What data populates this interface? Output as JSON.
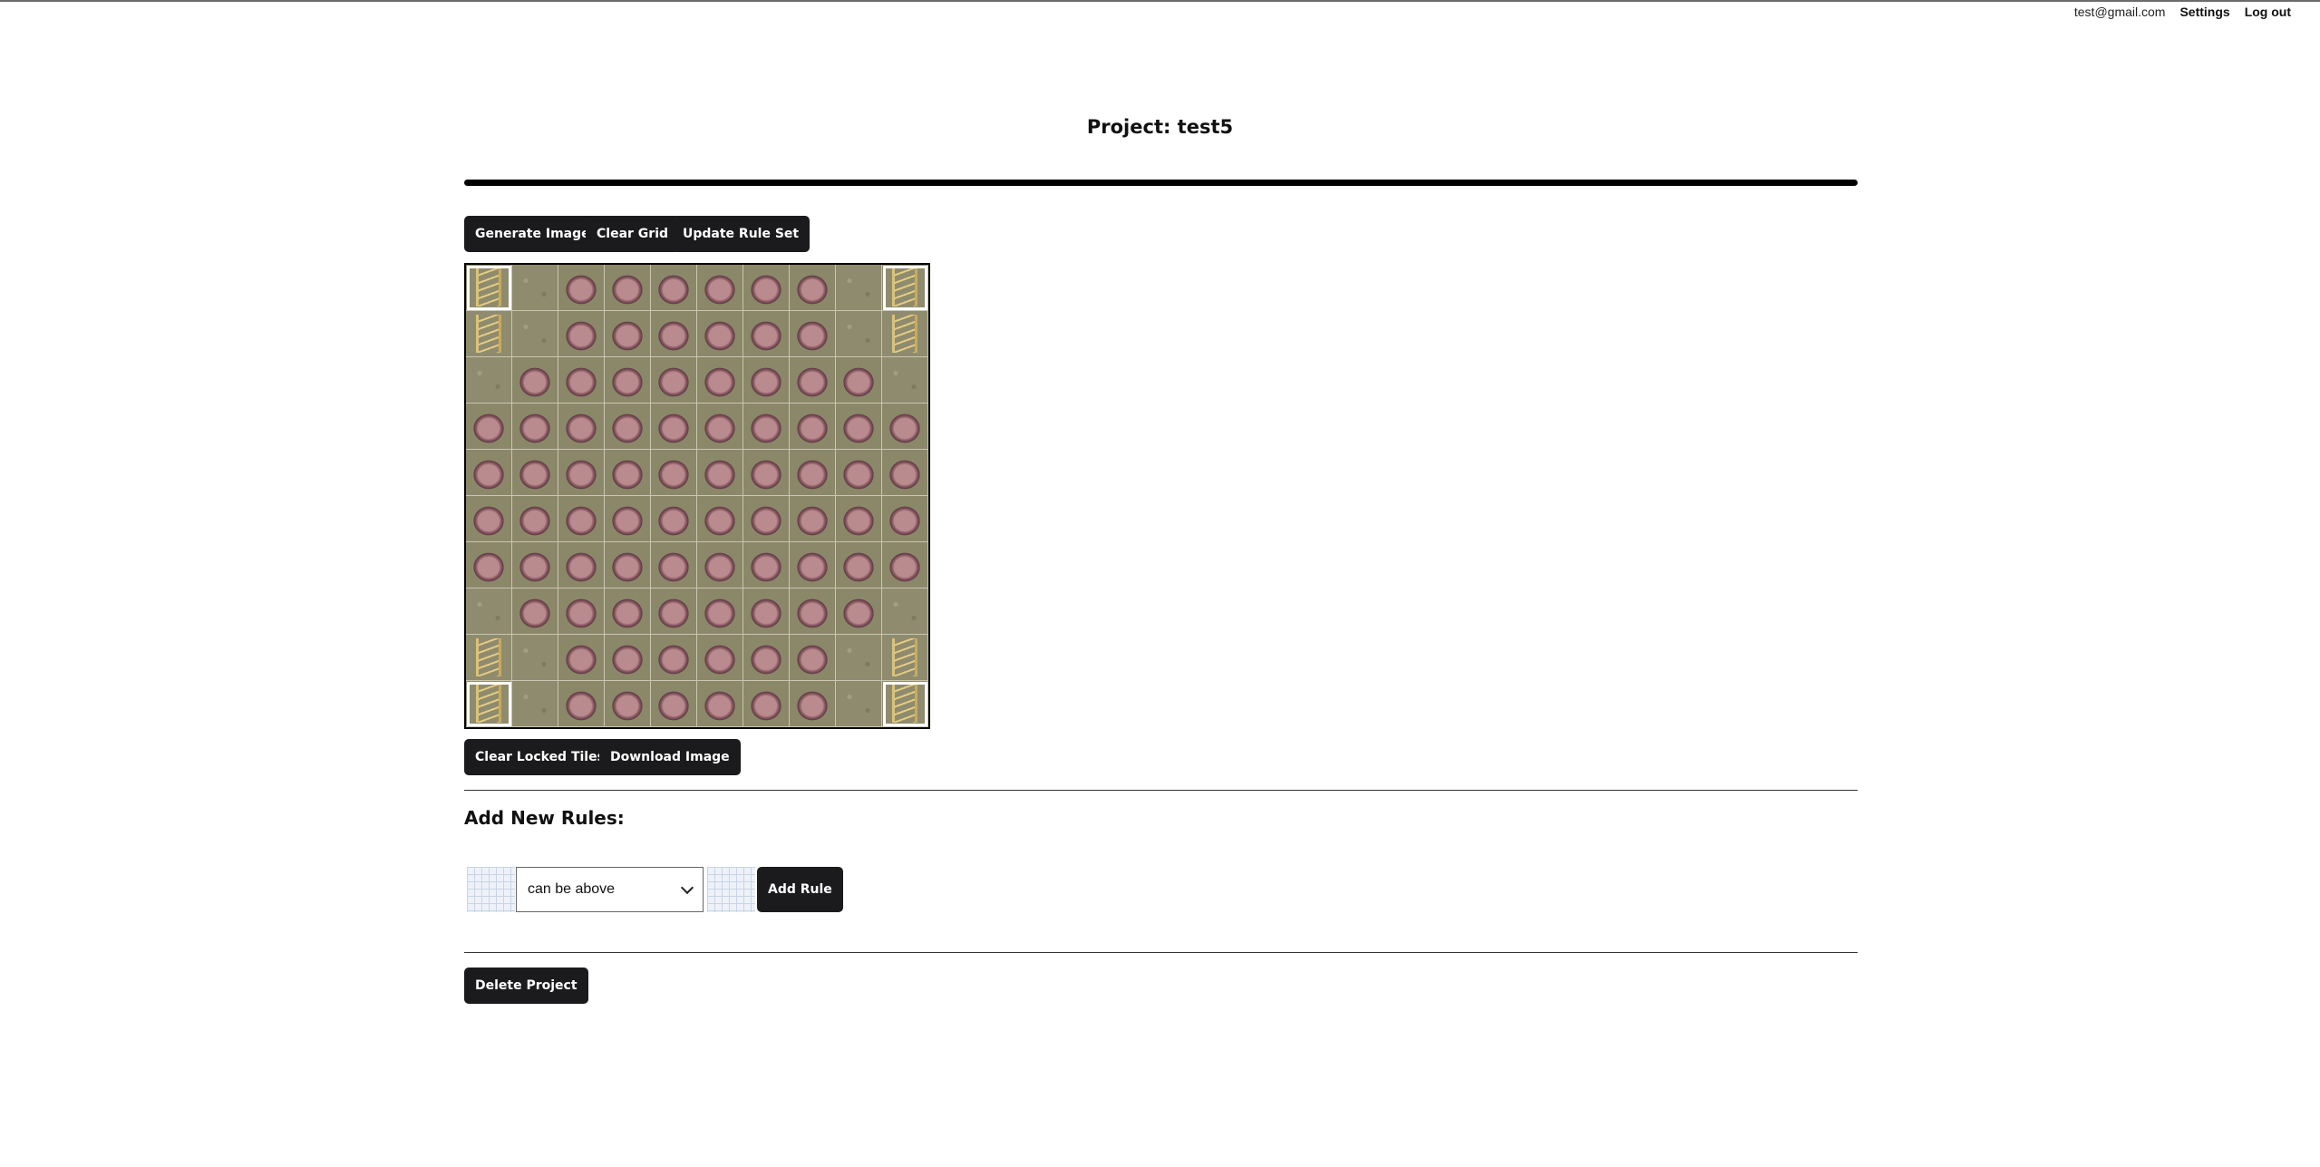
{
  "nav": {
    "email": "test@gmail.com",
    "settings": "Settings",
    "logout": "Log out"
  },
  "page": {
    "title": "Project: test5"
  },
  "toolbar": {
    "generate": "Generate Image",
    "clear_grid": "Clear Grid",
    "update_rules": "Update Rule Set"
  },
  "grid": {
    "rows": [
      [
        "ladder",
        "sand",
        "rock",
        "rock",
        "rock",
        "rock",
        "rock",
        "rock",
        "sand",
        "ladder"
      ],
      [
        "ladder",
        "sand",
        "rock",
        "rock",
        "rock",
        "rock",
        "rock",
        "rock",
        "sand",
        "ladder"
      ],
      [
        "sand",
        "rock",
        "rock",
        "rock",
        "rock",
        "rock",
        "rock",
        "rock",
        "rock",
        "sand"
      ],
      [
        "rock",
        "rock",
        "rock",
        "rock",
        "rock",
        "rock",
        "rock",
        "rock",
        "rock",
        "rock"
      ],
      [
        "rock",
        "rock",
        "rock",
        "rock",
        "rock",
        "rock",
        "rock",
        "rock",
        "rock",
        "rock"
      ],
      [
        "rock",
        "rock",
        "rock",
        "rock",
        "rock",
        "rock",
        "rock",
        "rock",
        "rock",
        "rock"
      ],
      [
        "rock",
        "rock",
        "rock",
        "rock",
        "rock",
        "rock",
        "rock",
        "rock",
        "rock",
        "rock"
      ],
      [
        "sand",
        "rock",
        "rock",
        "rock",
        "rock",
        "rock",
        "rock",
        "rock",
        "rock",
        "sand"
      ],
      [
        "ladder",
        "sand",
        "rock",
        "rock",
        "rock",
        "rock",
        "rock",
        "rock",
        "sand",
        "ladder"
      ],
      [
        "ladder",
        "sand",
        "rock",
        "rock",
        "rock",
        "rock",
        "rock",
        "rock",
        "sand",
        "ladder"
      ]
    ],
    "locked": [
      [
        0,
        0
      ],
      [
        0,
        9
      ],
      [
        9,
        0
      ],
      [
        9,
        9
      ]
    ]
  },
  "grid_actions": {
    "clear_locked": "Clear Locked Tiles",
    "download": "Download Image"
  },
  "rules": {
    "heading": "Add New Rules:",
    "relation": "can be above",
    "add": "Add Rule"
  },
  "danger": {
    "delete": "Delete Project"
  }
}
